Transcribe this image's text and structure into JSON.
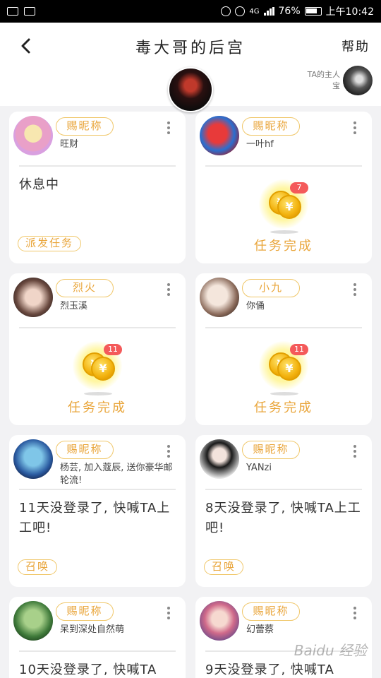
{
  "status_bar": {
    "battery": "76%",
    "network": "4G",
    "time": "上午10:42"
  },
  "header": {
    "back_icon": "chevron-left-icon",
    "title": "毒大哥的后宫",
    "help_label": "帮助",
    "owner_label_line1": "TA的主人",
    "owner_label_line2": "宝"
  },
  "cards": [
    {
      "badge": "赐昵称",
      "nick": "旺财",
      "status": "休息中",
      "action": "派发任务"
    },
    {
      "badge": "赐昵称",
      "nick": "一叶hf",
      "coin_count": "7",
      "done": "任务完成"
    },
    {
      "badge": "烈火",
      "nick": "烈玉溪",
      "coin_count": "11",
      "done": "任务完成"
    },
    {
      "badge": "小九",
      "nick": "你俑",
      "coin_count": "11",
      "done": "任务完成"
    },
    {
      "badge": "赐昵称",
      "nick": "杨芸, 加入蔻辰, 送你豪华邮轮流!",
      "status": "11天没登录了, 快喊TA上工吧!",
      "action": "召唤"
    },
    {
      "badge": "赐昵称",
      "nick": "YANzi",
      "status": "8天没登录了, 快喊TA上工吧!",
      "action": "召唤"
    },
    {
      "badge": "赐昵称",
      "nick": "呆到深处自然萌",
      "status": "10天没登录了, 快喊TA"
    },
    {
      "badge": "赐昵称",
      "nick": "幻蕾蔡",
      "status": "9天没登录了, 快喊TA"
    }
  ],
  "watermark": "Baidu 经验",
  "colors": {
    "accent": "#e9a53a",
    "badge_border": "#f0c76a",
    "badge_red": "#f45a5a"
  }
}
